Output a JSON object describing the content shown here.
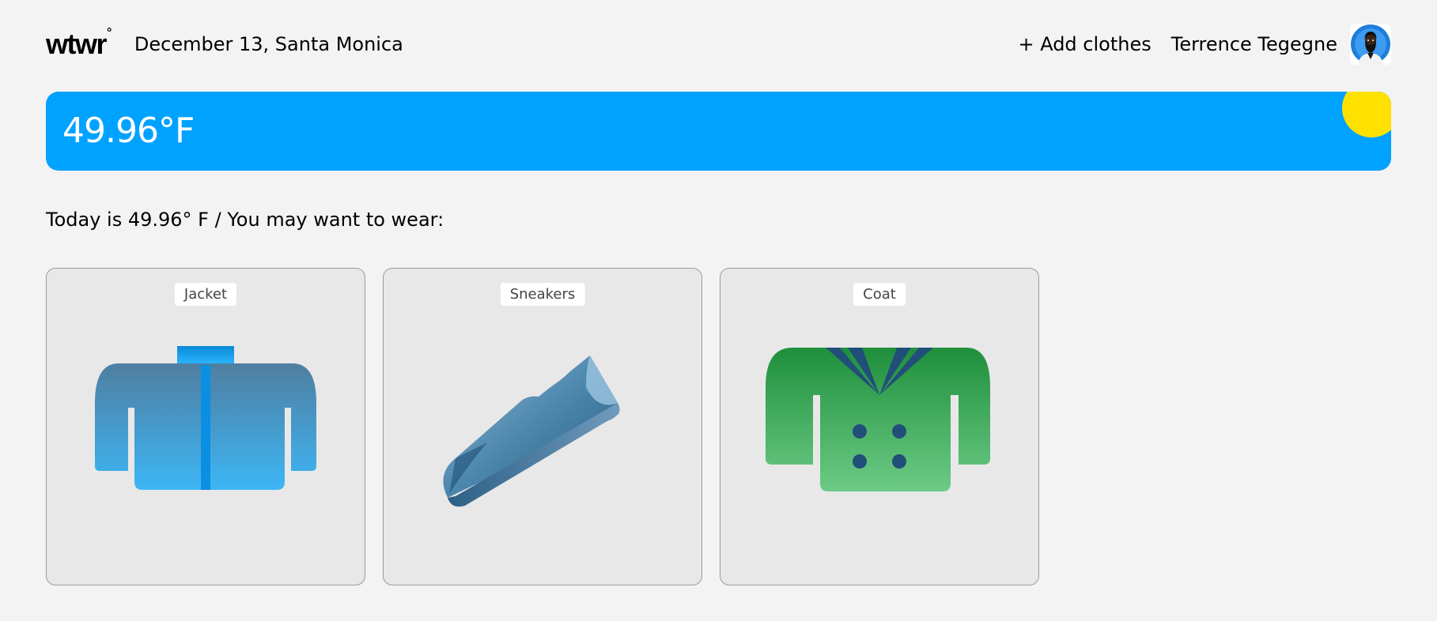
{
  "header": {
    "logo_text": "wtwr",
    "logo_degree": "°",
    "date_location": "December 13, Santa Monica",
    "add_clothes_label": "+ Add clothes",
    "user_name": "Terrence Tegegne"
  },
  "weather": {
    "temperature": "49.96°F",
    "condition_icon": "sun-icon",
    "card_color": "#00a2ff",
    "sun_color": "#ffe100"
  },
  "message": {
    "text": "Today is 49.96° F / You may want to wear:"
  },
  "cards": [
    {
      "name": "Jacket",
      "image_icon": "jacket-icon"
    },
    {
      "name": "Sneakers",
      "image_icon": "sneaker-icon"
    },
    {
      "name": "Coat",
      "image_icon": "coat-icon"
    }
  ]
}
